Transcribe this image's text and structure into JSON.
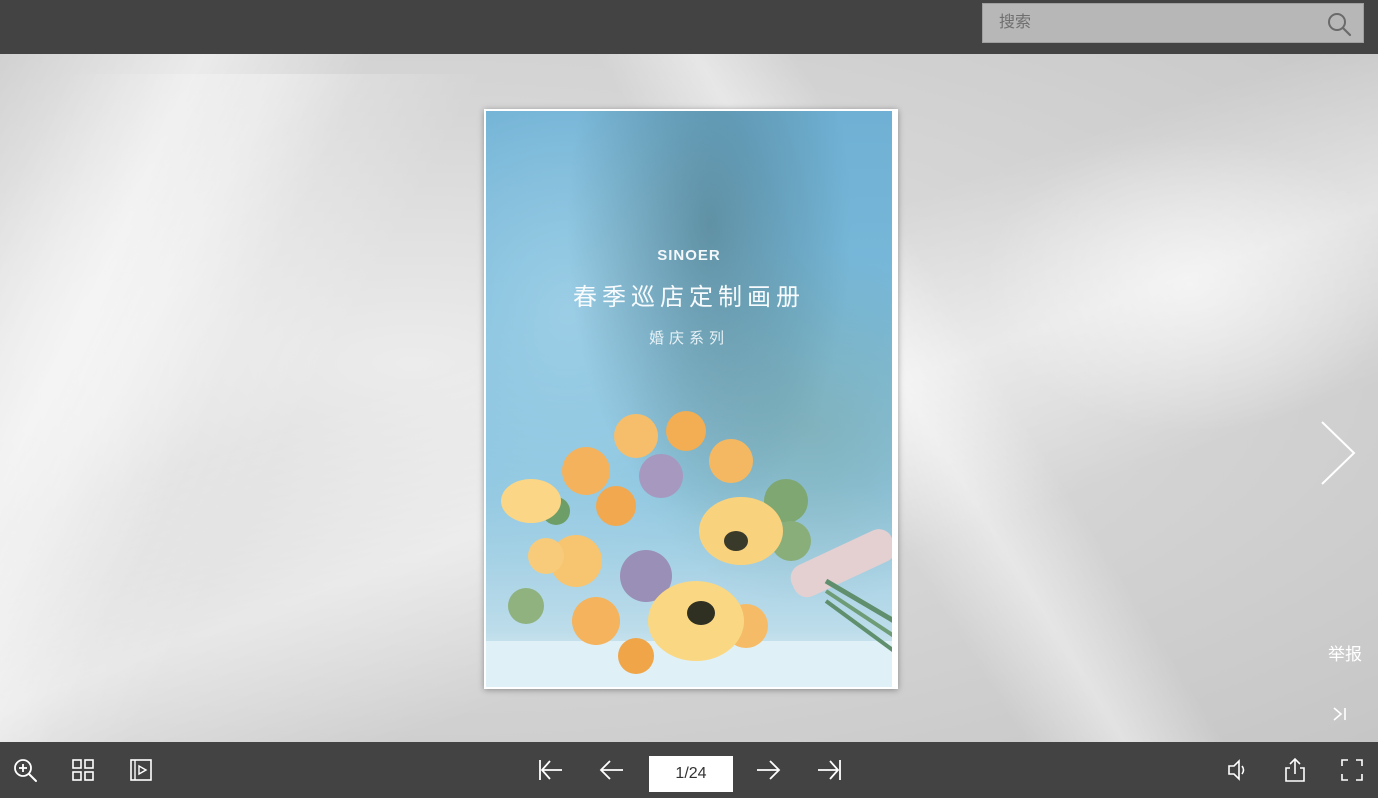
{
  "search": {
    "placeholder": "搜索",
    "icon": "search-icon"
  },
  "book": {
    "brand": "SINOER",
    "title": "春季巡店定制画册",
    "subtitle": "婚庆系列"
  },
  "side": {
    "next_icon": "chevron-right-icon",
    "report_label": "举报",
    "last_icon": "skip-to-end-icon"
  },
  "toolbar": {
    "left": [
      "zoom-in-icon",
      "thumbnails-grid-icon",
      "autoplay-icon"
    ],
    "nav": [
      "first-page-icon",
      "previous-page-icon",
      "next-page-icon",
      "last-page-icon"
    ],
    "page_indicator": "1/24",
    "right": [
      "sound-icon",
      "share-icon",
      "fullscreen-icon"
    ]
  },
  "colors": {
    "bar": "#434343",
    "search_bg": "#b7b7b7",
    "icon": "#ffffff"
  }
}
